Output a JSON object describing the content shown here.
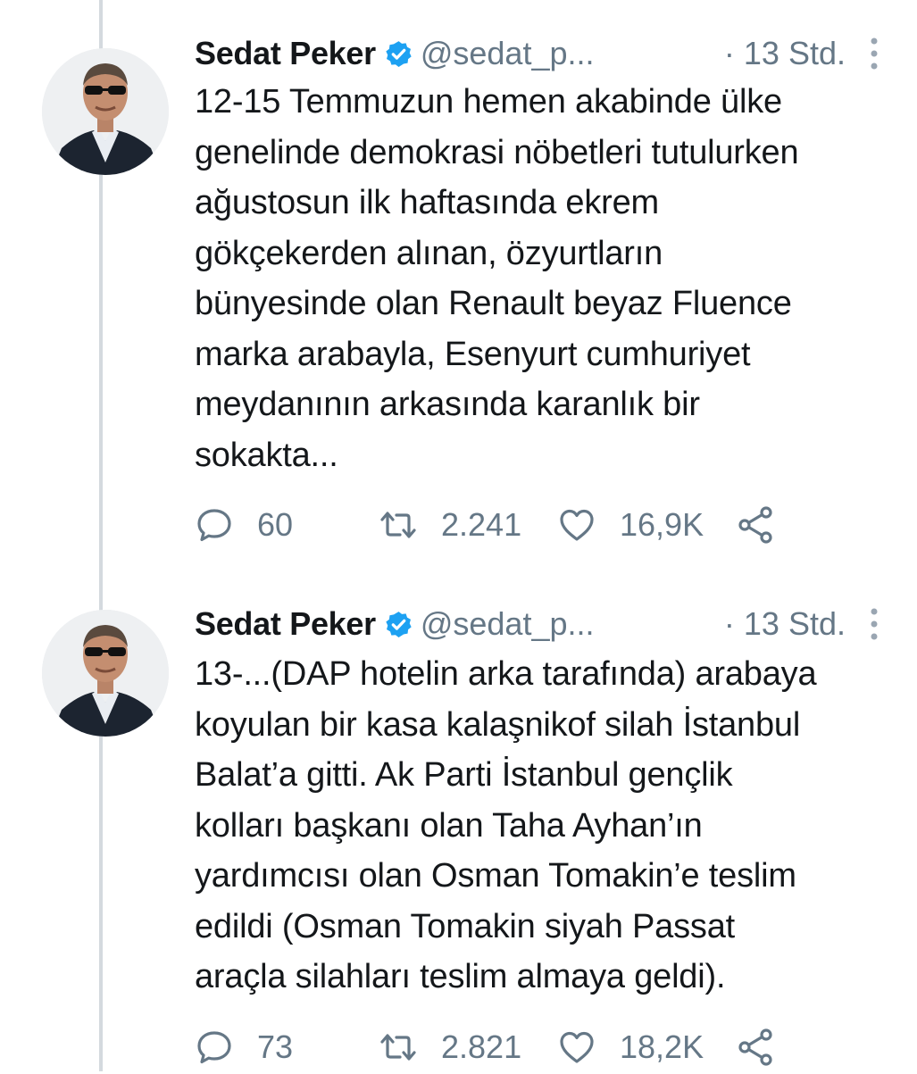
{
  "tweets": [
    {
      "author_name": "Sedat Peker",
      "handle": "@sedat_p...",
      "time": "· 13 Std.",
      "text": "12-15 Temmuzun hemen akabinde ülke\ngenelinde demokrasi nöbetleri tutulurken\nağustosun ilk haftasında ekrem\ngökçekerden alınan, özyurtların\nbünyesinde olan Renault beyaz Fluence\nmarka arabayla, Esenyurt cumhuriyet\nmeydanının arkasında karanlık bir\nsokakta...",
      "replies": "60",
      "retweets": "2.241",
      "likes": "16,9K"
    },
    {
      "author_name": "Sedat Peker",
      "handle": "@sedat_p...",
      "time": "· 13 Std.",
      "text": "13-...(DAP hotelin arka tarafında) arabaya\nkoyulan bir kasa kalaşnikof silah İstanbul\nBalat’a gitti. Ak Parti İstanbul gençlik\nkolları başkanı olan Taha Ayhan’ın\nyardımcısı olan Osman Tomakin’e teslim\nedildi (Osman Tomakin siyah Passat\naraçla silahları teslim almaya geldi).",
      "replies": "73",
      "retweets": "2.821",
      "likes": "18,2K"
    }
  ],
  "colors": {
    "text": "#14171a",
    "secondary": "#657786",
    "verified": "#1da1f2",
    "thread_line": "#d4d9de"
  },
  "icons": {
    "verified": "verified-badge-icon",
    "more": "more-vertical-icon",
    "reply": "reply-icon",
    "retweet": "retweet-icon",
    "like": "heart-icon",
    "share": "share-icon"
  }
}
